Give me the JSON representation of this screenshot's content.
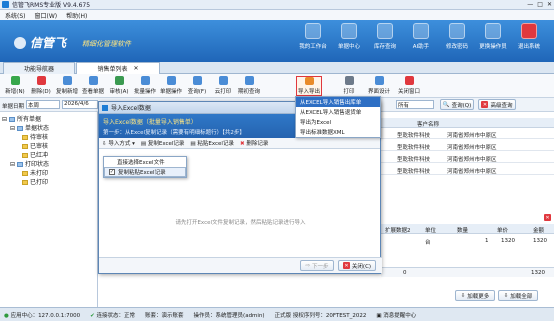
{
  "window": {
    "title": "信管飞RMS专业版 V9.4.675"
  },
  "menu": [
    "系统(S)",
    "窗口(W)",
    "帮助(H)"
  ],
  "banner": {
    "brand": "信管飞",
    "slogan": "精细化管理软件"
  },
  "top_icons": [
    "我的工作台",
    "单据中心",
    "库存查询",
    "AI助手",
    "修改密码",
    "更换操作员",
    "退出系统"
  ],
  "tabs": [
    "功能导航器",
    "销售单列表"
  ],
  "toolbar": [
    "新增(N)",
    "删除(D)",
    "复制新增",
    "查看单据",
    "审核(A)",
    "批量操作",
    "单据操作",
    "查询(F)",
    "云打印",
    "期初查询",
    "导入导出",
    "打印",
    "界面设计",
    "关闭窗口"
  ],
  "filter": {
    "date_label": "单据日期",
    "date_op": "本周",
    "date_value": "2026/4/6",
    "status_value": "所有",
    "query_btn": "查询(Q)",
    "reset_btn": "高级查询"
  },
  "tree": [
    {
      "label": "所有单据",
      "level": 0
    },
    {
      "label": "单据状态",
      "level": 1
    },
    {
      "label": "待审核",
      "level": 2
    },
    {
      "label": "已审核",
      "level": 2
    },
    {
      "label": "已红冲",
      "level": 2
    },
    {
      "label": "打印状态",
      "level": 1
    },
    {
      "label": "未打印",
      "level": 2
    },
    {
      "label": "已打印",
      "level": 2
    }
  ],
  "grid": {
    "col_header": "客户名称",
    "rows": [
      {
        "a": "型乾软件科技",
        "b": "河南省郑州市中原区"
      },
      {
        "a": "型乾软件科技",
        "b": "河南省郑州市中原区"
      },
      {
        "a": "型乾软件科技",
        "b": "河南省郑州市中原区"
      },
      {
        "a": "型乾软件科技",
        "b": "河南省郑州市中原区"
      }
    ]
  },
  "detail": {
    "headers": [
      "扩展数据2",
      "单位",
      "数量",
      "单价",
      "金额"
    ],
    "row": [
      "",
      "台",
      "1",
      "1320",
      "1320"
    ],
    "totals": [
      "",
      "",
      "0",
      "",
      "1320"
    ],
    "buttons": [
      "加载更多",
      "加载全部"
    ]
  },
  "dialog": {
    "title": "导入Excel数据",
    "heading": "导入Excel数据（批量导入销售单）",
    "step": "第一步：从Excel复制记录（需要有明细标题行）【共2步】",
    "tools": [
      "导入方式",
      "复制Excel记录",
      "粘贴Excel记录",
      "删除记录"
    ],
    "message": "请先打开Excel文件复制记录，然后粘贴记录进行导入",
    "next": "下一步",
    "close": "关闭(C)"
  },
  "import_menu": {
    "items": [
      "直接选择Excel文件",
      "复制粘贴Excel记录"
    ],
    "checked": 1
  },
  "export_menu": {
    "items": [
      "从EXCEL导入销售出库单",
      "从EXCEL导入销售退货单",
      "导出为Excel",
      "导出标准数据XML"
    ],
    "highlighted": 0
  },
  "status": {
    "server": "应用中心：127.0.0.1:7000",
    "conn": "连接状态：正常",
    "acct": "账套：演示账套",
    "operator": "操作员：系统管理员(admin)",
    "edition": "正式版 授权序列号：20FTEST_2022",
    "msg": "消息提醒中心"
  },
  "colors": {
    "banner": "#2a74c6",
    "accent": "#2e6fc4",
    "danger": "#e0383e"
  }
}
